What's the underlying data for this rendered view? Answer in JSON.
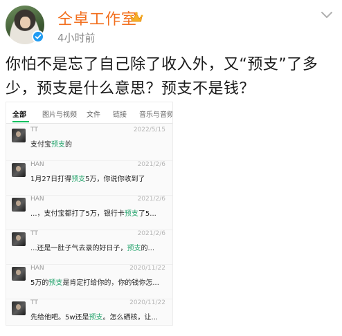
{
  "post": {
    "username": "仝卓工作室",
    "time": "4小时前",
    "text": "你怕不是忘了自己除了收入外，又“预支”了多少，预支是什么意思？预支不是钱？"
  },
  "record": {
    "tabs": [
      "全部",
      "图片与视频",
      "文件",
      "链接",
      "音乐与音频"
    ],
    "messages": [
      {
        "sender": "TT",
        "date": "2022/5/15",
        "parts": [
          "支付宝",
          "预支",
          "的"
        ]
      },
      {
        "sender": "HAN",
        "date": "2021/2/6",
        "parts": [
          "1月27日打得",
          "预支",
          "5万，你说你收到了"
        ]
      },
      {
        "sender": "HAN",
        "date": "2021/2/6",
        "parts": [
          "...，支付宝都打了5万，银行卡",
          "预支",
          "了5..."
        ]
      },
      {
        "sender": "TT",
        "date": "2021/2/6",
        "parts": [
          "...还是一肚子气去录的好日子，",
          "预支",
          "的..."
        ]
      },
      {
        "sender": "HAN",
        "date": "2020/11/22",
        "parts": [
          "5万的",
          "预支",
          "是肯定打给你的，你的钱你怎..."
        ]
      },
      {
        "sender": "TT",
        "date": "2020/11/22",
        "parts": [
          "先给他吧。5w还是",
          "预支",
          "。怎么硒核，让..."
        ]
      }
    ]
  },
  "colors": {
    "username": "#f26f1e",
    "keyword": "#22a36b",
    "verified": "#1f9bf2"
  },
  "icons": {
    "verified": "verified-check-icon",
    "crown": "crown-icon",
    "more": "chevron-down-icon"
  }
}
